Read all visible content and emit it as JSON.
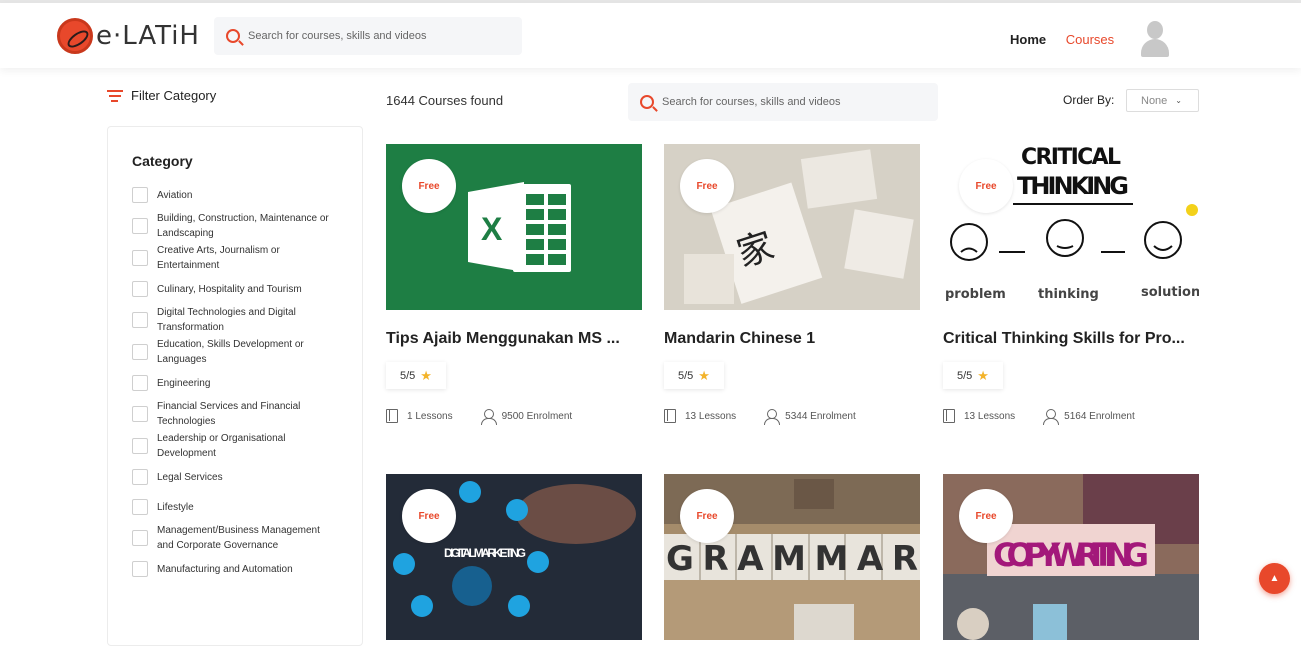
{
  "brand": {
    "name": "e·LATiH",
    "accent": "#e8482b"
  },
  "header": {
    "search_placeholder": "Search for courses, skills and videos",
    "nav": [
      {
        "label": "Home",
        "active": false
      },
      {
        "label": "Courses",
        "active": true
      }
    ]
  },
  "filter": {
    "heading": "Filter Category",
    "category_title": "Category",
    "categories": [
      "Aviation",
      "Building, Construction, Maintenance or Landscaping",
      "Creative Arts, Journalism or Entertainment",
      "Culinary, Hospitality and Tourism",
      "Digital Technologies and Digital Transformation",
      "Education, Skills Development or Languages",
      "Engineering",
      "Financial Services and Financial Technologies",
      "Leadership or Organisational Development",
      "Legal Services",
      "Lifestyle",
      "Management/Business Management and Corporate Governance",
      "Manufacturing and Automation"
    ]
  },
  "results": {
    "count_text": "1644 Courses found",
    "search_placeholder": "Search for courses, skills and videos",
    "order_label": "Order By:",
    "order_value": "None"
  },
  "courses": [
    {
      "badge": "Free",
      "title": "Tips Ajaib Menggunakan MS ...",
      "rating": "5/5",
      "lessons": "1 Lessons",
      "enrolment": "9500 Enrolment",
      "thumb_text": "",
      "icon": "excel-logo"
    },
    {
      "badge": "Free",
      "title": "Mandarin Chinese 1",
      "rating": "5/5",
      "lessons": "13 Lessons",
      "enrolment": "5344 Enrolment",
      "thumb_text": "家",
      "icon": "chinese-cards"
    },
    {
      "badge": "Free",
      "title": "Critical Thinking Skills for Pro...",
      "rating": "5/5",
      "lessons": "13 Lessons",
      "enrolment": "5164 Enrolment",
      "thumb_text": "CRITICAL THINKING",
      "icon": "thinking-faces"
    },
    {
      "badge": "Free",
      "title": "",
      "rating": "",
      "lessons": "",
      "enrolment": "",
      "thumb_text": "DIGITAL MARKETING",
      "icon": "digital-marketing"
    },
    {
      "badge": "Free",
      "title": "",
      "rating": "",
      "lessons": "",
      "enrolment": "",
      "thumb_text": "GRAMMAR",
      "icon": "grammar-blocks"
    },
    {
      "badge": "Free",
      "title": "",
      "rating": "",
      "lessons": "",
      "enrolment": "",
      "thumb_text": "COPYWRITING",
      "icon": "copywriting"
    }
  ],
  "thumb_labels": {
    "problem": "problem",
    "thinking": "thinking",
    "solution": "solution"
  }
}
